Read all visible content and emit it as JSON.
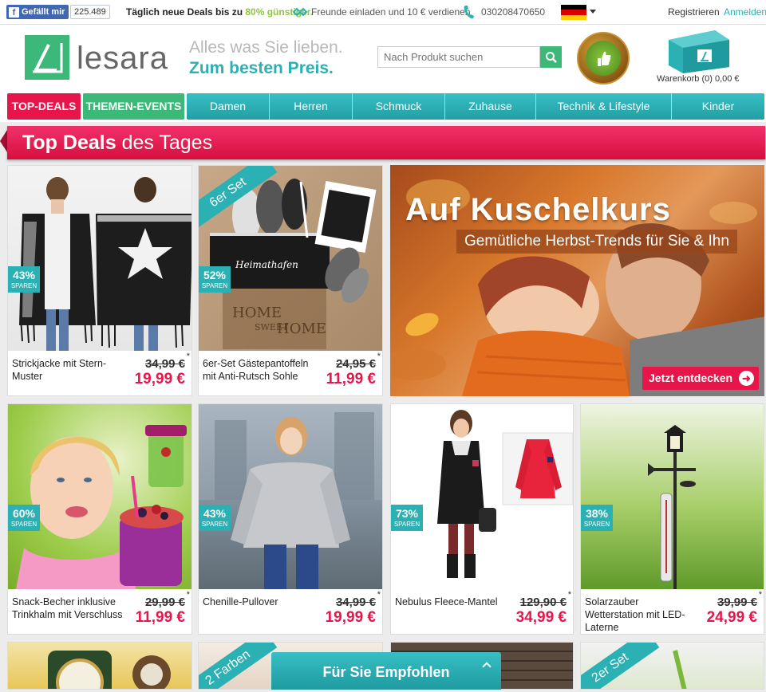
{
  "topbar": {
    "fb_label": "Gefällt mir",
    "fb_icon": "f",
    "fb_count": "225.489",
    "deal_msg_pre": "Täglich neue Deals bis zu ",
    "deal_msg_pct": "80% günstiger.",
    "invite_text": "Freunde einladen und 10 € verdienen",
    "phone": "030208470650",
    "register": "Registrieren",
    "login": "Anmelden",
    "colors": {
      "accent": "#2bb0b4",
      "green": "#8dc63f"
    }
  },
  "header": {
    "logo_text": "lesara",
    "slogan_line1": "Alles was Sie lieben.",
    "slogan_line2": "Zum besten Preis.",
    "search_placeholder": "Nach Produkt suchen",
    "cart_label": "Warenkorb (0) 0,00 €"
  },
  "nav": {
    "top_deals": "TOP-DEALS",
    "theme_events": "THEMEN-EVENTS",
    "items": [
      "Damen",
      "Herren",
      "Schmuck",
      "Zuhause",
      "Technik & Lifestyle",
      "Kinder"
    ]
  },
  "banner": {
    "title_bold": "Top Deals",
    "title_rest": " des Tages"
  },
  "hero": {
    "title": "Auf Kuschelkurs",
    "subtitle": "Gemütliche Herbst-Trends für Sie & Ihn",
    "button": "Jetzt entdecken"
  },
  "products": [
    {
      "name": "Strickjacke mit Stern-Muster",
      "old_price": "34,99 €",
      "new_price": "19,99 €",
      "discount": "43%",
      "save": "SPAREN"
    },
    {
      "name": "6er-Set Gästepantoffeln mit Anti-Rutsch Sohle",
      "old_price": "24,95 €",
      "new_price": "11,99 €",
      "discount": "52%",
      "save": "SPAREN",
      "ribbon": "6er Set"
    },
    {
      "name": "Snack-Becher inklusive Trinkhalm mit Verschluss",
      "old_price": "29,99 €",
      "new_price": "11,99 €",
      "discount": "60%",
      "save": "SPAREN"
    },
    {
      "name": "Chenille-Pullover",
      "old_price": "34,99 €",
      "new_price": "19,99 €",
      "discount": "43%",
      "save": "SPAREN"
    },
    {
      "name": "Nebulus Fleece-Mantel",
      "old_price": "129,90 €",
      "new_price": "34,99 €",
      "discount": "73%",
      "save": "SPAREN"
    },
    {
      "name": "Solarzauber Wetterstation mit LED-Laterne",
      "old_price": "39,99 €",
      "new_price": "24,99 €",
      "discount": "38%",
      "save": "SPAREN"
    }
  ],
  "price_note": "*",
  "row3": {
    "ribbon_left": "2 Farben",
    "ribbon_right": "2er Set"
  },
  "slipper_text": {
    "mat1": "HOME",
    "mat2": "SWEET",
    "mat3": "HOME",
    "bag": "Heimathafen"
  },
  "recommend": "Für Sie Empfohlen"
}
